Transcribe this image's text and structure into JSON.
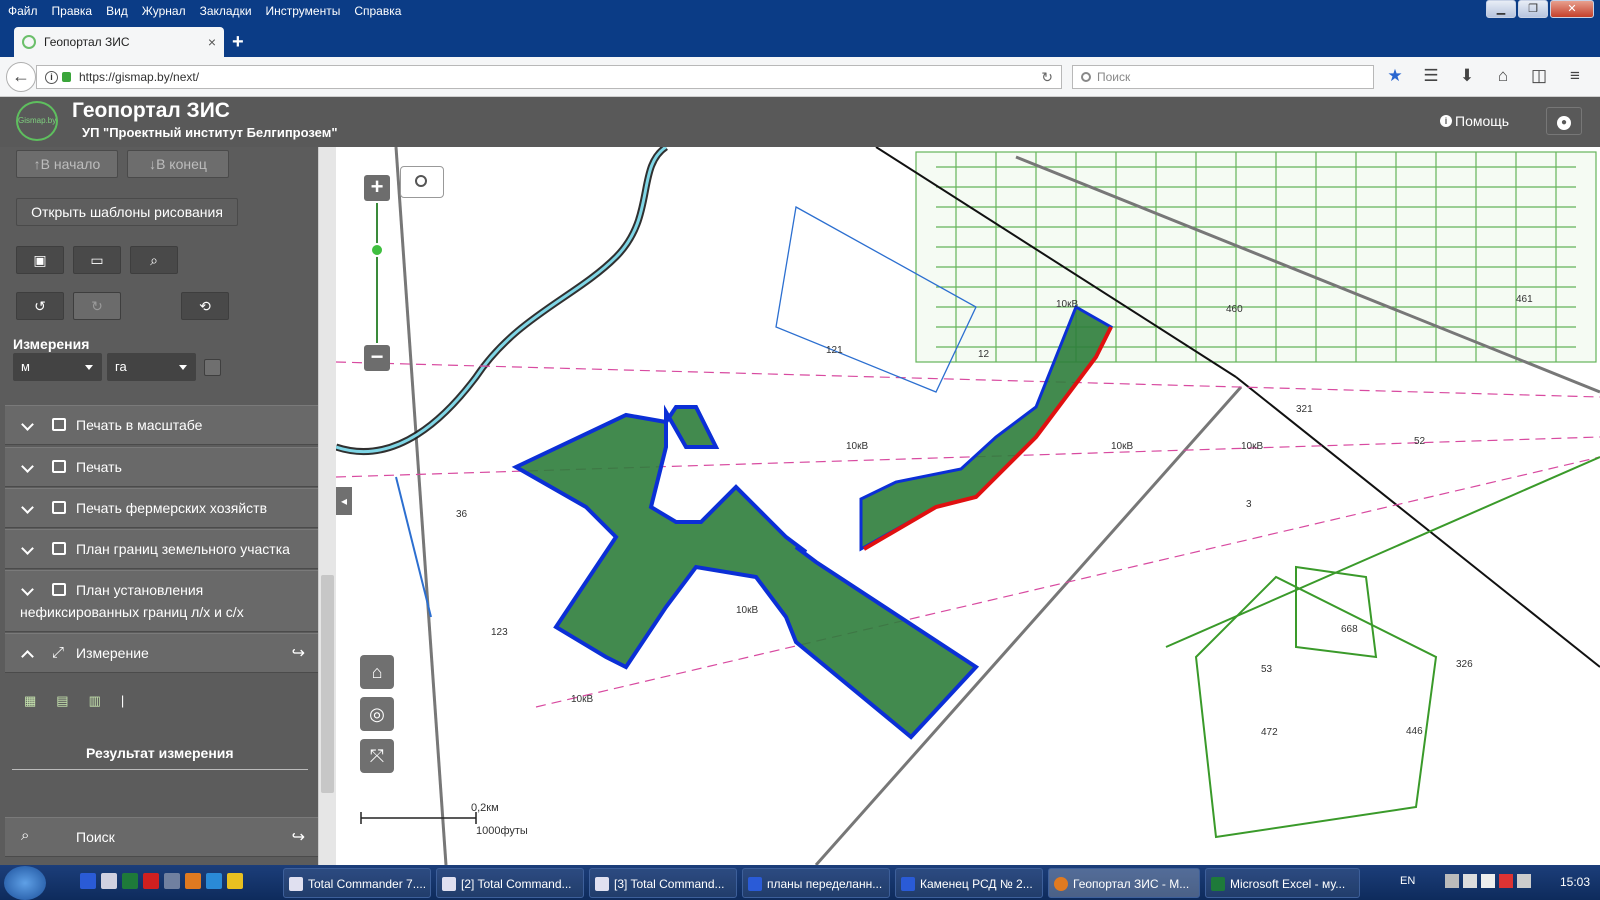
{
  "menu": [
    "Файл",
    "Правка",
    "Вид",
    "Журнал",
    "Закладки",
    "Инструменты",
    "Справка"
  ],
  "tab": {
    "title": "Геопортал ЗИС",
    "close": "×"
  },
  "new_tab": "+",
  "url": "https://gismap.by/next/",
  "search_placeholder": "Поиск",
  "app": {
    "logo": "Gismap.by",
    "title": "Геопортал ЗИС",
    "subtitle": "УП \"Проектный институт Белгипрозем\"",
    "help": "Помощь"
  },
  "panel": {
    "to_start": "↑В начало",
    "to_end": "↓В конец",
    "open_templates": "Открыть шаблоны рисования",
    "measurements_label": "Измерения",
    "unit_length": "м",
    "unit_area": "га",
    "sections": [
      "Печать в масштабе",
      "Печать",
      "Печать фермерских хозяйств",
      "План границ земельного участка",
      "План установления",
      "нефиксированных границ л/х и с/х",
      "Измерение",
      "Поиск"
    ],
    "result": "Результат измерения",
    "separator": "|"
  },
  "map": {
    "labels": [
      "10кВ",
      "10кВ",
      "10кВ",
      "10кВ",
      "10кВ",
      "10кВ",
      "321",
      "461",
      "460",
      "3",
      "53",
      "668",
      "326",
      "472",
      "446",
      "123",
      "36",
      "121",
      "12",
      "52"
    ],
    "scale_km": "0,2км",
    "scale_ft": "1000футы"
  },
  "taskbar": {
    "tasks": [
      "Total Commander 7....",
      "[2] Total Command...",
      "[3] Total Command...",
      "планы переделанн...",
      "Каменец РСД № 2...",
      "Геопортал ЗИС - М...",
      "Microsoft Excel - му..."
    ],
    "lang": "EN",
    "time": "15:03"
  },
  "colors": {
    "parcel_fill": "#2e7d3b",
    "parcel_stroke": "#0b2fd6",
    "highlight": "#e01010",
    "panel": "#5c5c5c"
  }
}
